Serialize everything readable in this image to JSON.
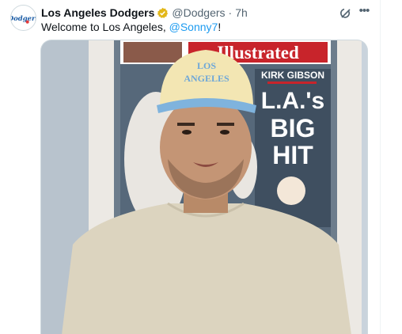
{
  "tweet": {
    "author_name": "Los Angeles Dodgers",
    "handle": "@Dodgers",
    "separator": "·",
    "time": "7h",
    "text_before": "Welcome to Los Angeles, ",
    "mention": "@Sonny7",
    "text_after": "!",
    "avatar_icon": "dodgers-logo-icon",
    "avatar_text": "Dodgers",
    "verified_icon": "verified-gold-badge-icon",
    "verified_color": "#e2b719",
    "mention_color": "#1d9bf0"
  },
  "actions": {
    "grok_icon": "grok-icon",
    "more_icon": "more-options-icon",
    "more_label": "•••"
  },
  "media": {
    "kind": "video-still",
    "description_icon": "video-thumbnail",
    "magazine_masthead": "Illustrated",
    "magazine_name": "KIRK GIBSON",
    "magazine_headline_line1": "L.A.'s",
    "magazine_headline_line2": "BIG",
    "magazine_headline_line3": "HIT",
    "cap_text_line1": "LOS",
    "cap_text_line2": "ANGELES"
  }
}
